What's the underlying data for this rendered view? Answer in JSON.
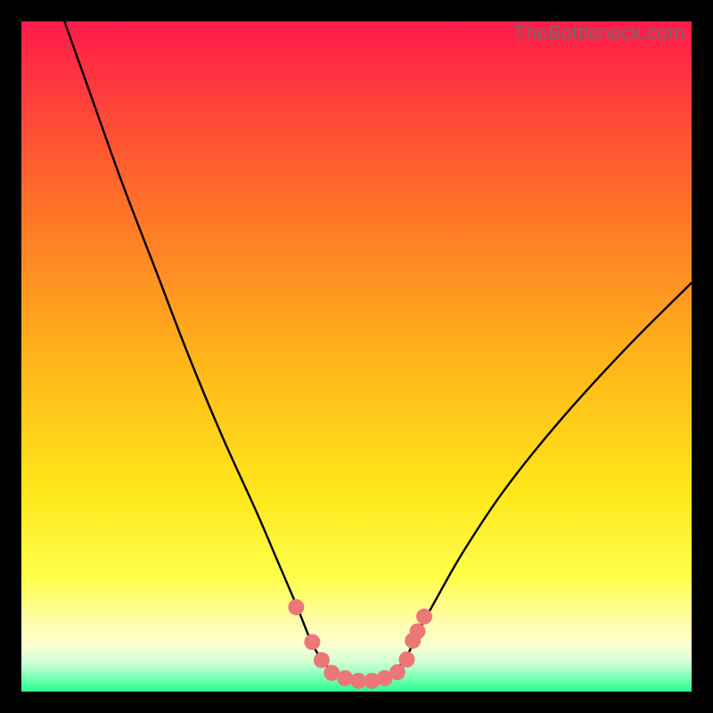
{
  "watermark": {
    "text": "TheBottleneck.com"
  },
  "colors": {
    "black": "#000000",
    "grad_top": "#ff1a4a",
    "grad_mid1": "#ff7a1a",
    "grad_mid2": "#ffd21a",
    "grad_mid3": "#ffff4a",
    "grad_soft_yellow": "#fffca0",
    "grad_pale_green": "#caffca",
    "grad_green": "#27ff8d",
    "curve": "#000000",
    "marker_fill": "#ec7777",
    "marker_stroke": "#ec7777"
  },
  "chart_data": {
    "type": "line",
    "title": "",
    "xlabel": "",
    "ylabel": "",
    "xlim": [
      0,
      100
    ],
    "ylim": [
      0,
      100
    ],
    "series": [
      {
        "name": "bottleneck-curve",
        "x": [
          0,
          5,
          10,
          15,
          20,
          25,
          30,
          35,
          38,
          41,
          43,
          44.5,
          46,
          48,
          50,
          52,
          54,
          56,
          57.5,
          59,
          62,
          66,
          72,
          80,
          90,
          100
        ],
        "y": [
          118,
          104,
          90,
          76,
          63,
          50,
          38,
          27,
          20,
          13,
          8,
          5.2,
          3.4,
          2.1,
          1.6,
          1.6,
          2.1,
          3.4,
          5.2,
          8.5,
          14,
          21,
          30,
          40,
          51,
          61
        ]
      }
    ],
    "markers": [
      {
        "x": 41.0,
        "y": 12.6
      },
      {
        "x": 43.4,
        "y": 7.4
      },
      {
        "x": 44.8,
        "y": 4.7
      },
      {
        "x": 46.3,
        "y": 2.8
      },
      {
        "x": 48.3,
        "y": 2.0
      },
      {
        "x": 50.3,
        "y": 1.6
      },
      {
        "x": 52.3,
        "y": 1.6
      },
      {
        "x": 54.2,
        "y": 2.0
      },
      {
        "x": 56.1,
        "y": 2.9
      },
      {
        "x": 57.5,
        "y": 4.8
      },
      {
        "x": 58.4,
        "y": 7.6
      },
      {
        "x": 59.1,
        "y": 9.0
      },
      {
        "x": 60.1,
        "y": 11.2
      }
    ],
    "marker_radius": 9
  }
}
